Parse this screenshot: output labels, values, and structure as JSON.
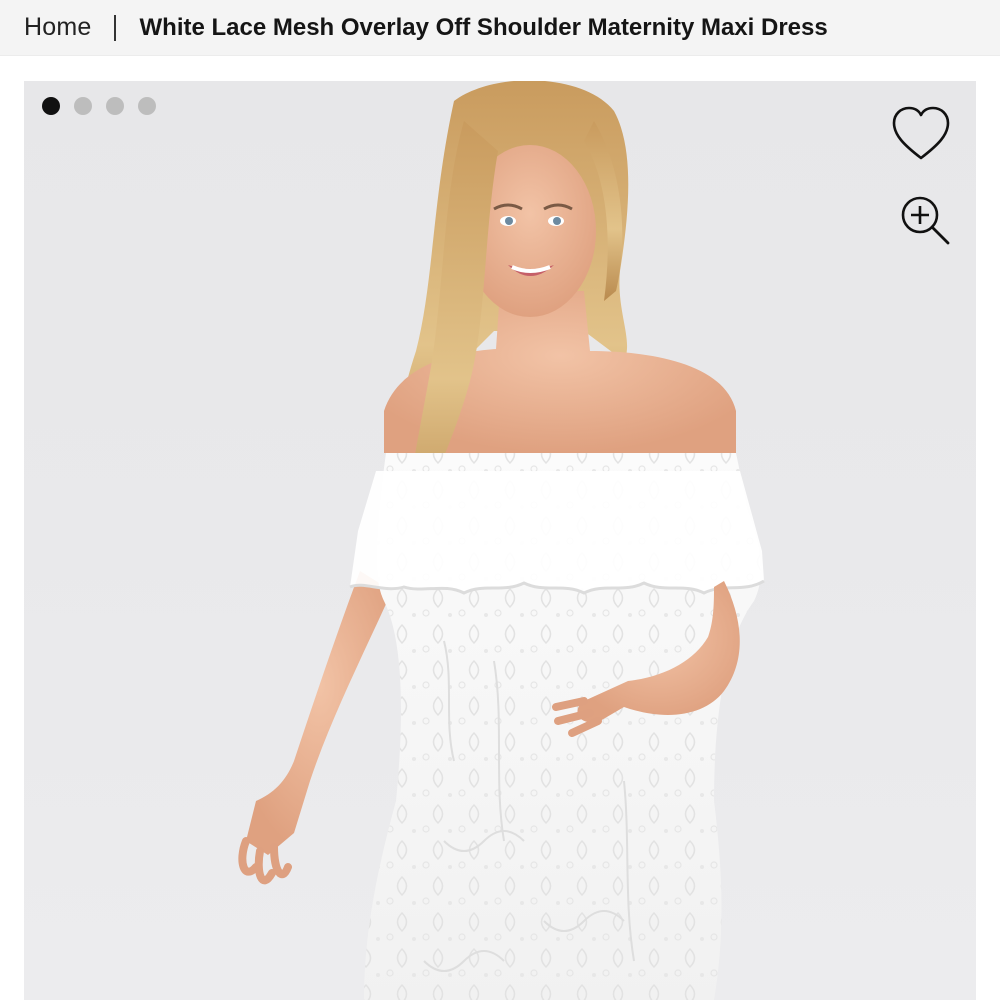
{
  "breadcrumb": {
    "home_label": "Home",
    "current_label": "White Lace Mesh Overlay Off Shoulder Maternity Maxi Dress"
  },
  "gallery": {
    "image_count": 4,
    "active_index": 0,
    "icons": {
      "favorite": "heart-outline-icon",
      "zoom": "zoom-in-icon"
    },
    "colors": {
      "background": "#e8e8ea",
      "active_dot": "#111111",
      "inactive_dot": "#bdbdbd"
    }
  }
}
